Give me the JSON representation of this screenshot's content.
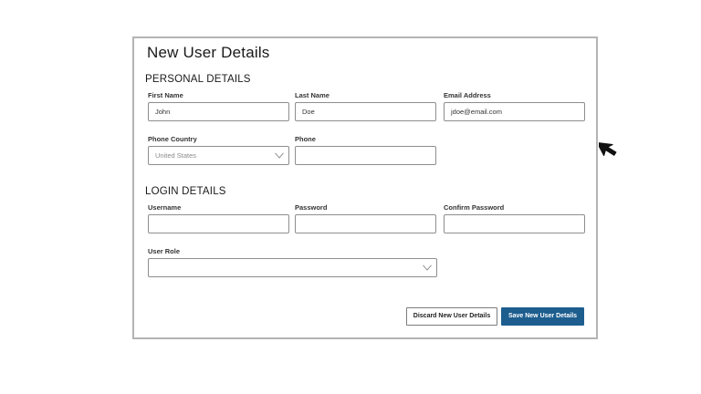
{
  "form": {
    "title": "New User Details",
    "personal": {
      "heading": "PERSONAL DETAILS",
      "first_name": {
        "label": "First Name",
        "value": "John"
      },
      "last_name": {
        "label": "Last Name",
        "value": "Doe"
      },
      "email": {
        "label": "Email Address",
        "value": "jdoe@email.com"
      },
      "phone_country": {
        "label": "Phone Country",
        "value": "United States"
      },
      "phone": {
        "label": "Phone",
        "value": ""
      }
    },
    "login": {
      "heading": "LOGIN DETAILS",
      "username": {
        "label": "Username",
        "value": ""
      },
      "password": {
        "label": "Password",
        "value": ""
      },
      "confirm_password": {
        "label": "Confirm Password",
        "value": ""
      },
      "user_role": {
        "label": "User Role",
        "value": ""
      }
    },
    "actions": {
      "discard_label": "Discard New User Details",
      "save_label": "Save New User Details"
    }
  },
  "icons": {
    "dropdown": "chevron-down-icon",
    "cursor": "mouse-pointer-icon"
  },
  "colors": {
    "primary_button": "#1d5e8f",
    "panel_border": "#b4b4b4"
  }
}
